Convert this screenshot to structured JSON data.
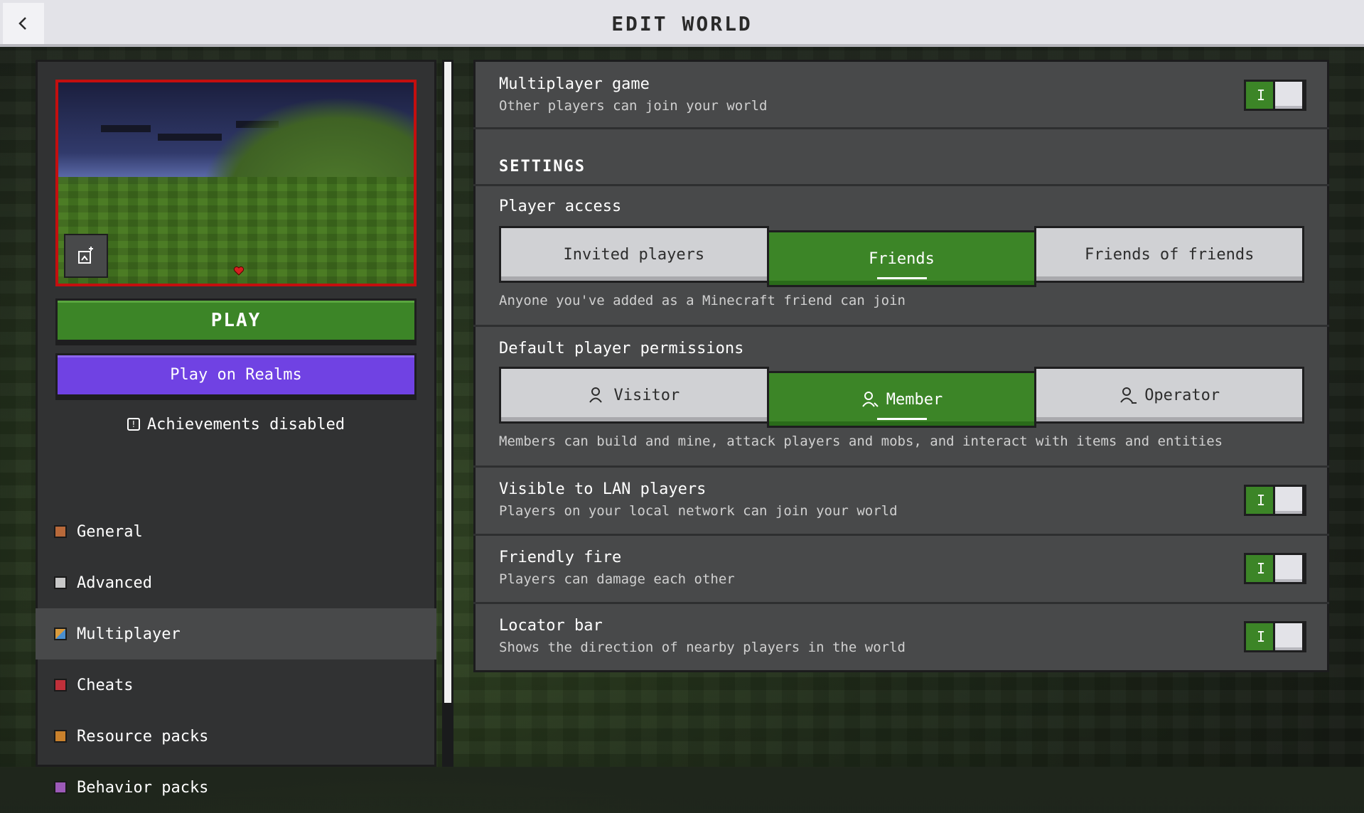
{
  "header": {
    "title": "EDIT WORLD",
    "back_icon": "chevron-left-icon"
  },
  "left": {
    "play_label": "PLAY",
    "realms_label": "Play on Realms",
    "achievements_text": "Achievements disabled",
    "nav": [
      {
        "label": "General",
        "icon": "general-icon",
        "color": "#b8693a"
      },
      {
        "label": "Advanced",
        "icon": "advanced-icon",
        "color": "#c8c8c8"
      },
      {
        "label": "Multiplayer",
        "icon": "multiplayer-icon",
        "color": "#d99b3d",
        "active": true
      },
      {
        "label": "Cheats",
        "icon": "cheats-icon",
        "color": "#c0303a"
      },
      {
        "label": "Resource packs",
        "icon": "resource-packs-icon",
        "color": "#c9812c"
      },
      {
        "label": "Behavior packs",
        "icon": "behavior-packs-icon",
        "color": "#9c5ab8"
      }
    ]
  },
  "right": {
    "multiplayer": {
      "title": "Multiplayer game",
      "desc": "Other players can join your world",
      "on_label": "I"
    },
    "settings_header": "SETTINGS",
    "player_access": {
      "title": "Player access",
      "options": [
        "Invited players",
        "Friends",
        "Friends of friends"
      ],
      "selected": "Friends",
      "desc": "Anyone you've added as a Minecraft friend can join"
    },
    "permissions": {
      "title": "Default player permissions",
      "options": [
        "Visitor",
        "Member",
        "Operator"
      ],
      "selected": "Member",
      "desc": "Members can build and mine, attack players and mobs, and interact with items and entities"
    },
    "lan": {
      "title": "Visible to LAN players",
      "desc": "Players on your local network can join your world",
      "on_label": "I"
    },
    "friendly_fire": {
      "title": "Friendly fire",
      "desc": "Players can damage each other",
      "on_label": "I"
    },
    "locator": {
      "title": "Locator bar",
      "desc": "Shows the direction of nearby players in the world",
      "on_label": "I"
    }
  },
  "colors": {
    "accent_green": "#3c8527",
    "realms_purple": "#7042e3",
    "preview_border": "#c40f0f"
  }
}
